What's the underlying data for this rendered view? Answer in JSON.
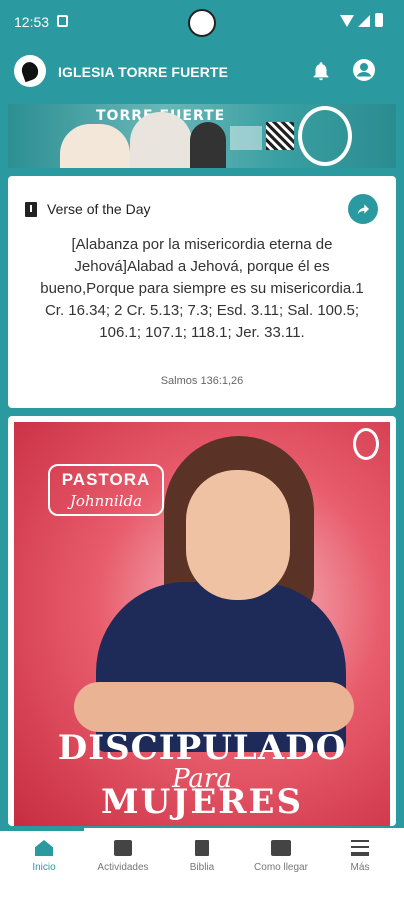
{
  "status_bar": {
    "time": "12:53"
  },
  "app_bar": {
    "title": "IGLESIA TORRE FUERTE"
  },
  "banner": {
    "brand": "TORRE   FUERTE"
  },
  "verse_card": {
    "heading": "Verse of the Day",
    "text": "[Alabanza por la misericordia eterna de Jehová]Alabad a Jehová, porque él es bueno,Porque para siempre es su misericordia.1 Cr. 16.34; 2 Cr. 5.13; 7.3; Esd. 3.11; Sal. 100.5; 106.1; 107.1; 118.1; Jer. 33.11.",
    "reference": "Salmos 136:1,26"
  },
  "poster": {
    "tag_line1": "PASTORA",
    "tag_line2": "Johnnilda",
    "title_line1": "DISCIPULADO",
    "title_line2": "Para",
    "title_line3": "MUJERES"
  },
  "bottom_nav": {
    "items": [
      {
        "label": "Inicio",
        "icon": "home-icon",
        "active": true
      },
      {
        "label": "Actividades",
        "icon": "calendar-icon",
        "active": false
      },
      {
        "label": "Biblia",
        "icon": "bible-icon",
        "active": false
      },
      {
        "label": "Como llegar",
        "icon": "map-icon",
        "active": false
      },
      {
        "label": "Más",
        "icon": "menu-icon",
        "active": false
      }
    ]
  },
  "colors": {
    "accent": "#2a9aa0"
  }
}
